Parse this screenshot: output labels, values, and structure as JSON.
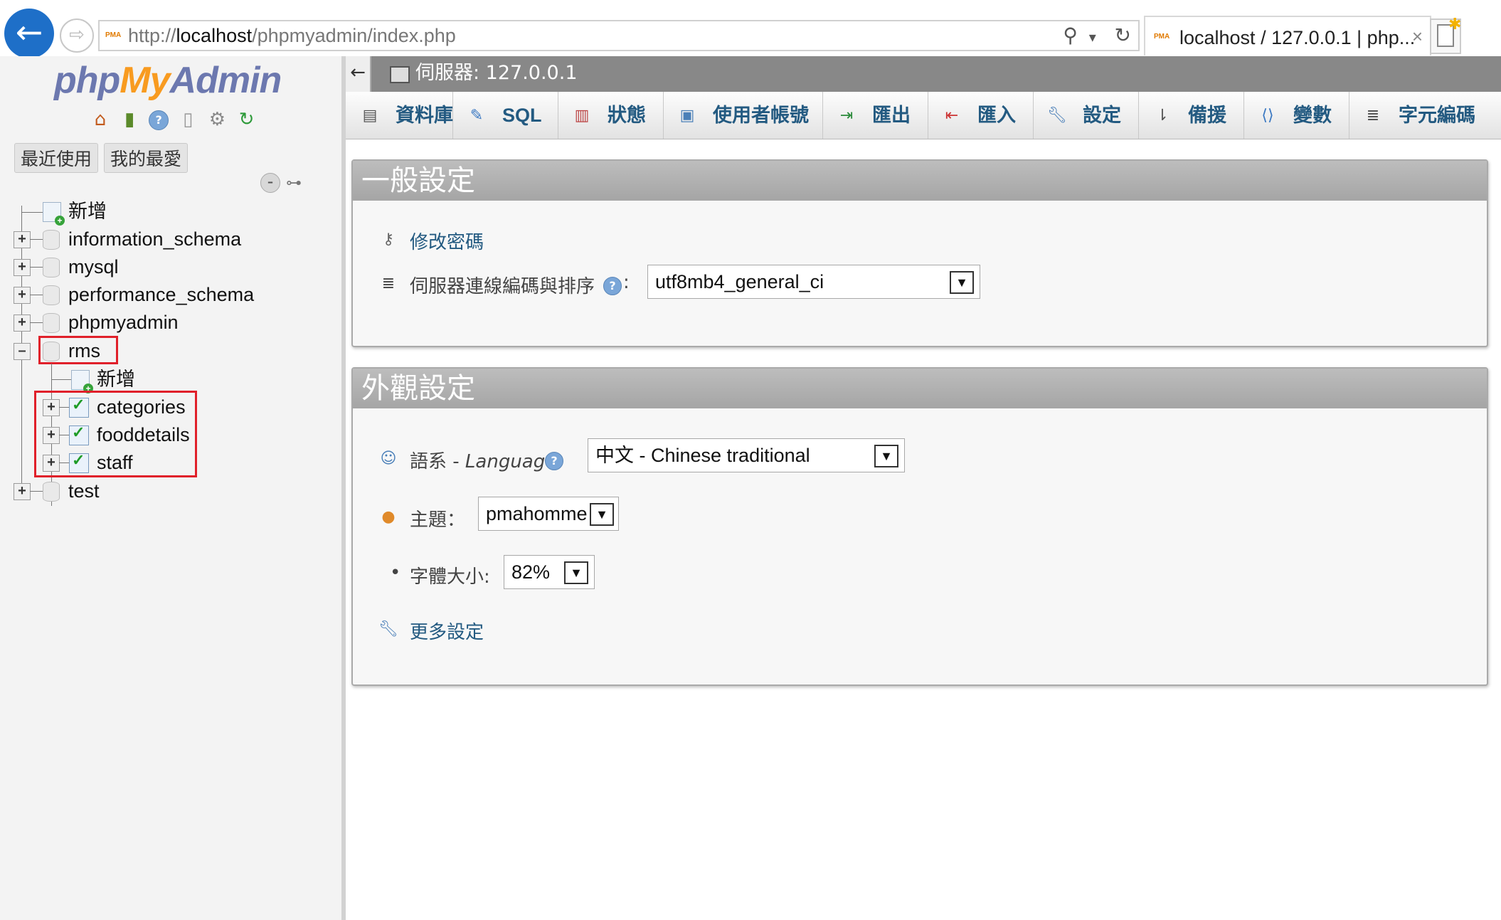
{
  "browser": {
    "url_prefix": "http://",
    "url_host": "localhost",
    "url_path": "/phpmyadmin/index.php",
    "tab_title": "localhost / 127.0.0.1 | php...",
    "favicon_text": "PMA",
    "back_glyph": "←",
    "forward_glyph": "⇨",
    "search_glyph": "⚲",
    "dropdown_glyph": "▾",
    "refresh_glyph": "↻",
    "close_glyph": "×"
  },
  "sidebar": {
    "logo": {
      "php": "php",
      "my": "My",
      "admin": "Admin"
    },
    "quick_buttons": [
      "最近使用",
      "我的最愛"
    ],
    "tree": {
      "new_label": "新增",
      "databases": [
        "information_schema",
        "mysql",
        "performance_schema",
        "phpmyadmin",
        "rms",
        "test"
      ],
      "rms_new_label": "新增",
      "rms_tables": [
        "categories",
        "fooddetails",
        "staff"
      ]
    }
  },
  "main": {
    "back_glyph": "←",
    "server_title": "伺服器: 127.0.0.1",
    "tabs": [
      "資料庫",
      "SQL",
      "狀態",
      "使用者帳號",
      "匯出",
      "匯入",
      "設定",
      "備援",
      "變數",
      "字元編碼"
    ],
    "general_settings": {
      "title": "一般設定",
      "change_password": "修改密碼",
      "collation_label": "伺服器連線編碼與排序",
      "collation_colon": ":",
      "collation_value": "utf8mb4_general_ci"
    },
    "appearance_settings": {
      "title": "外觀設定",
      "language_label": "語系 - ",
      "language_label_en": "Language",
      "language_value": "中文 - Chinese traditional",
      "theme_label": "主題：",
      "theme_value": "pmahomme",
      "fontsize_bullet": "•",
      "fontsize_label": "字體大小:",
      "fontsize_value": "82%",
      "more_settings": "更多設定"
    }
  },
  "colors": {
    "accent_link": "#235a81",
    "server_bar": "#888888",
    "panel_header": "#b0b0b0",
    "highlight_box": "#e0202a",
    "browser_back": "#1e6fc8"
  }
}
